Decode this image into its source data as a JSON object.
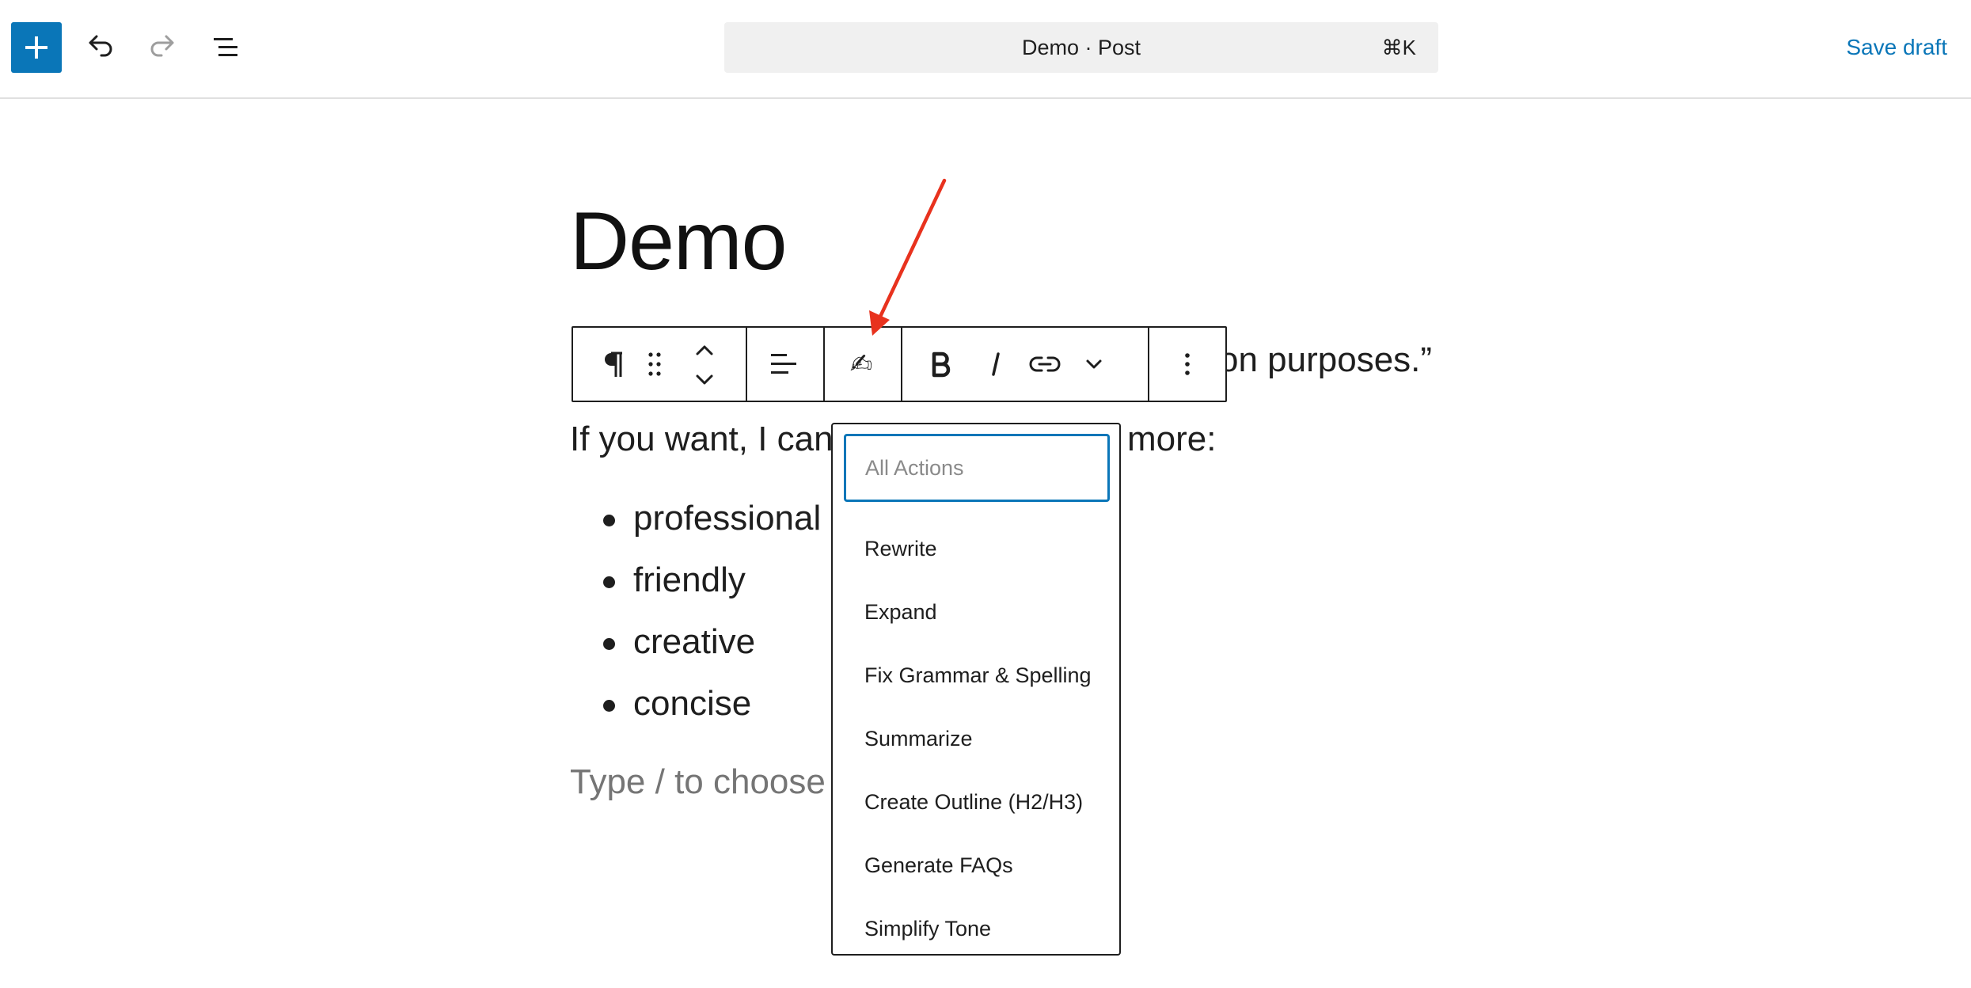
{
  "header": {
    "document_title": "Demo · Post",
    "shortcut": "⌘K",
    "save_label": "Save draft"
  },
  "post": {
    "title": "Demo",
    "paragraph_1_visible_end": "on purposes.”",
    "paragraph_2_start": "If you want, I can",
    "paragraph_2_end": "more:",
    "list_items": [
      "professional",
      "friendly",
      "creative",
      "concise"
    ],
    "placeholder": "Type / to choose"
  },
  "block_toolbar": {
    "ai_icon": "✍"
  },
  "ai_menu": {
    "search_placeholder": "All Actions",
    "items": [
      "Rewrite",
      "Expand",
      "Fix Grammar & Spelling",
      "Summarize",
      "Create Outline (H2/H3)",
      "Generate FAQs",
      "Simplify Tone"
    ]
  },
  "colors": {
    "accent": "#0a76b8",
    "annotation_arrow": "#e8321e"
  }
}
